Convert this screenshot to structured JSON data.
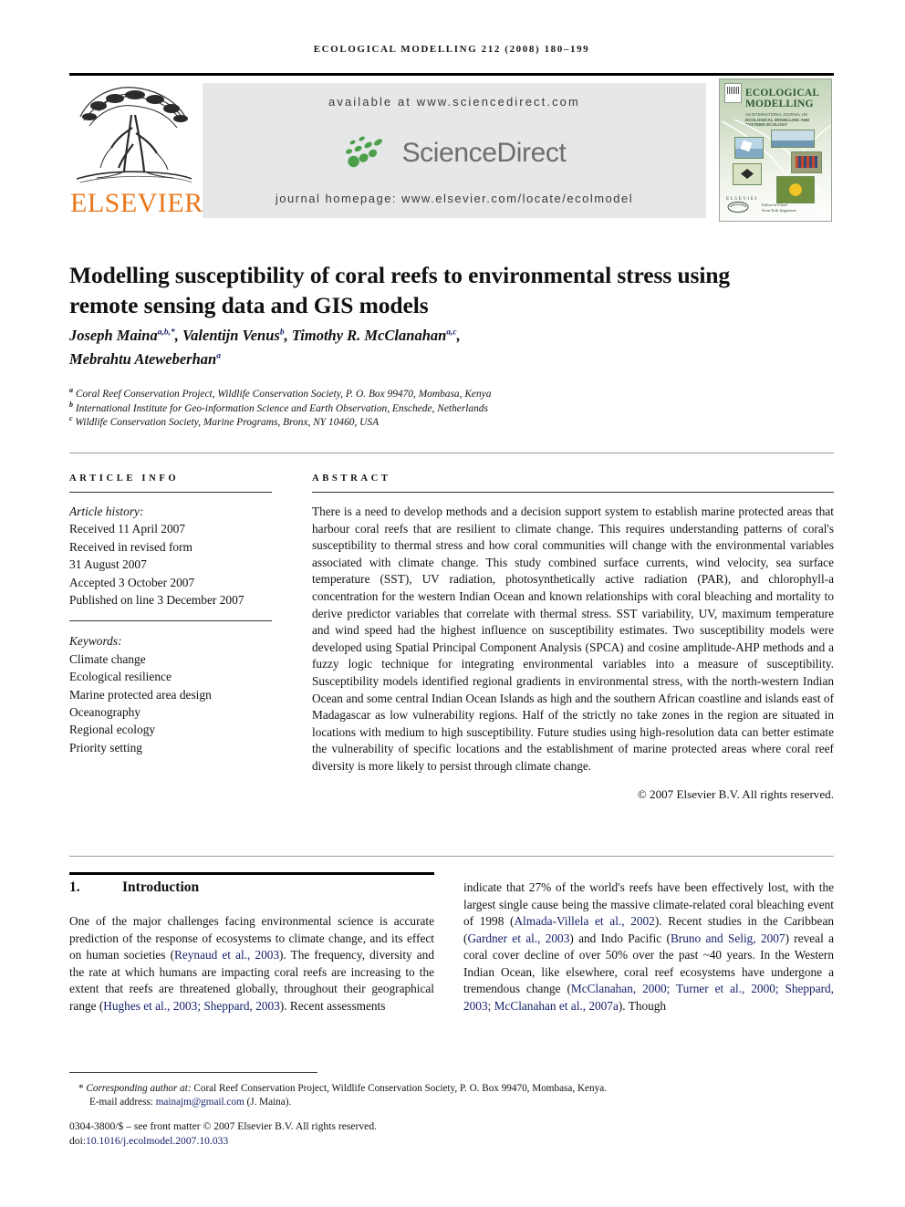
{
  "running_head": "ECOLOGICAL MODELLING 212 (2008) 180–199",
  "masthead": {
    "publisher_name": "ELSEVIER",
    "available_at": "available at www.sciencedirect.com",
    "sciencedirect_wordmark": "ScienceDirect",
    "journal_homepage": "journal homepage: www.elsevier.com/locate/ecolmodel",
    "cover": {
      "title_line1": "ECOLOGICAL",
      "title_line2": "MODELLING",
      "subtitle_line1": "AN INTERNATIONAL JOURNAL ON",
      "subtitle_line2": "ECOLOGICAL MODELLING AND",
      "subtitle_line3": "SYSTEMS ECOLOGY",
      "editor_line1": "Editor-in-Chief",
      "editor_line2": "Sven Erik Jørgensen"
    }
  },
  "article": {
    "title": "Modelling susceptibility of coral reefs to environmental stress using remote sensing data and GIS models",
    "authors_line1_a": "Joseph Maina",
    "authors_line1_a_sup": "a,b,*",
    "authors_line1_b": ", Valentijn Venus",
    "authors_line1_b_sup": "b",
    "authors_line1_c": ", Timothy R. McClanahan",
    "authors_line1_c_sup": "a,c",
    "authors_line1_d": ",",
    "authors_line2": "Mebrahtu Ateweberhan",
    "authors_line2_sup": "a",
    "affiliations": [
      {
        "marker": "a",
        "text": "Coral Reef Conservation Project, Wildlife Conservation Society, P. O. Box 99470, Mombasa, Kenya"
      },
      {
        "marker": "b",
        "text": "International Institute for Geo-information Science and Earth Observation, Enschede, Netherlands"
      },
      {
        "marker": "c",
        "text": "Wildlife Conservation Society, Marine Programs, Bronx, NY 10460, USA"
      }
    ]
  },
  "article_info": {
    "heading": "ARTICLE INFO",
    "history_label": "Article history:",
    "history_lines": [
      "Received 11 April 2007",
      "Received in revised form",
      "31 August 2007",
      "Accepted 3 October 2007",
      "Published on line 3 December 2007"
    ],
    "keywords_label": "Keywords:",
    "keywords": [
      "Climate change",
      "Ecological resilience",
      "Marine protected area design",
      "Oceanography",
      "Regional ecology",
      "Priority setting"
    ]
  },
  "abstract": {
    "heading": "ABSTRACT",
    "text": "There is a need to develop methods and a decision support system to establish marine protected areas that harbour coral reefs that are resilient to climate change. This requires understanding patterns of coral's susceptibility to thermal stress and how coral communities will change with the environmental variables associated with climate change. This study combined surface currents, wind velocity, sea surface temperature (SST), UV radiation, photosynthetically active radiation (PAR), and chlorophyll-a concentration for the western Indian Ocean and known relationships with coral bleaching and mortality to derive predictor variables that correlate with thermal stress. SST variability, UV, maximum temperature and wind speed had the highest influence on susceptibility estimates. Two susceptibility models were developed using Spatial Principal Component Analysis (SPCA) and cosine amplitude-AHP methods and a fuzzy logic technique for integrating environmental variables into a measure of susceptibility. Susceptibility models identified regional gradients in environmental stress, with the north-western Indian Ocean and some central Indian Ocean Islands as high and the southern African coastline and islands east of Madagascar as low vulnerability regions. Half of the strictly no take zones in the region are situated in locations with medium to high susceptibility. Future studies using high-resolution data can better estimate the vulnerability of specific locations and the establishment of marine protected areas where coral reef diversity is more likely to persist through climate change.",
    "copyright": "© 2007 Elsevier B.V. All rights reserved."
  },
  "introduction": {
    "number": "1.",
    "heading": "Introduction",
    "left_p1_t1": "One of the major challenges facing environmental science is accurate prediction of the response of ecosystems to climate change, and its effect on human societies (",
    "left_c1": "Reynaud et al., 2003",
    "left_p1_t2": "). The frequency, diversity and the rate at which humans are impacting coral reefs are increasing to the extent that reefs are threatened globally, throughout their geographical range (",
    "left_c2": "Hughes et al., 2003; Sheppard, 2003",
    "left_p1_t3": "). Recent assessments",
    "right_t1": "indicate that 27% of the world's reefs have been effectively lost, with the largest single cause being the massive climate-related coral bleaching event of 1998 (",
    "right_c1": "Almada-Villela et al., 2002",
    "right_t2": "). Recent studies in the Caribbean (",
    "right_c2": "Gardner et al., 2003",
    "right_t3": ") and Indo Pacific (",
    "right_c3": "Bruno and Selig, 2007",
    "right_t4": ") reveal a coral cover decline of over 50% over the past ~40 years. In the Western Indian Ocean, like elsewhere, coral reef ecosystems have undergone a tremendous change (",
    "right_c4": "McClanahan, 2000; Turner et al., 2000; Sheppard, 2003; McClanahan et al., 2007a",
    "right_t5": "). Though"
  },
  "footer": {
    "corresponding_marker": "*",
    "corresponding_label": "Corresponding author at:",
    "corresponding_text": "Coral Reef Conservation Project, Wildlife Conservation Society, P. O. Box 99470, Mombasa, Kenya.",
    "email_label": "E-mail address:",
    "email": "mainajm@gmail.com",
    "email_suffix": "(J. Maina).",
    "issn_line": "0304-3800/$ – see front matter © 2007 Elsevier B.V. All rights reserved.",
    "doi_label": "doi:",
    "doi": "10.1016/j.ecolmodel.2007.10.033"
  },
  "colors": {
    "elsevier_orange": "#E8761A",
    "sciencedirect_green": "#4CA04C",
    "citation_blue": "#16216b",
    "banner_gray": "#e6e7e8"
  }
}
